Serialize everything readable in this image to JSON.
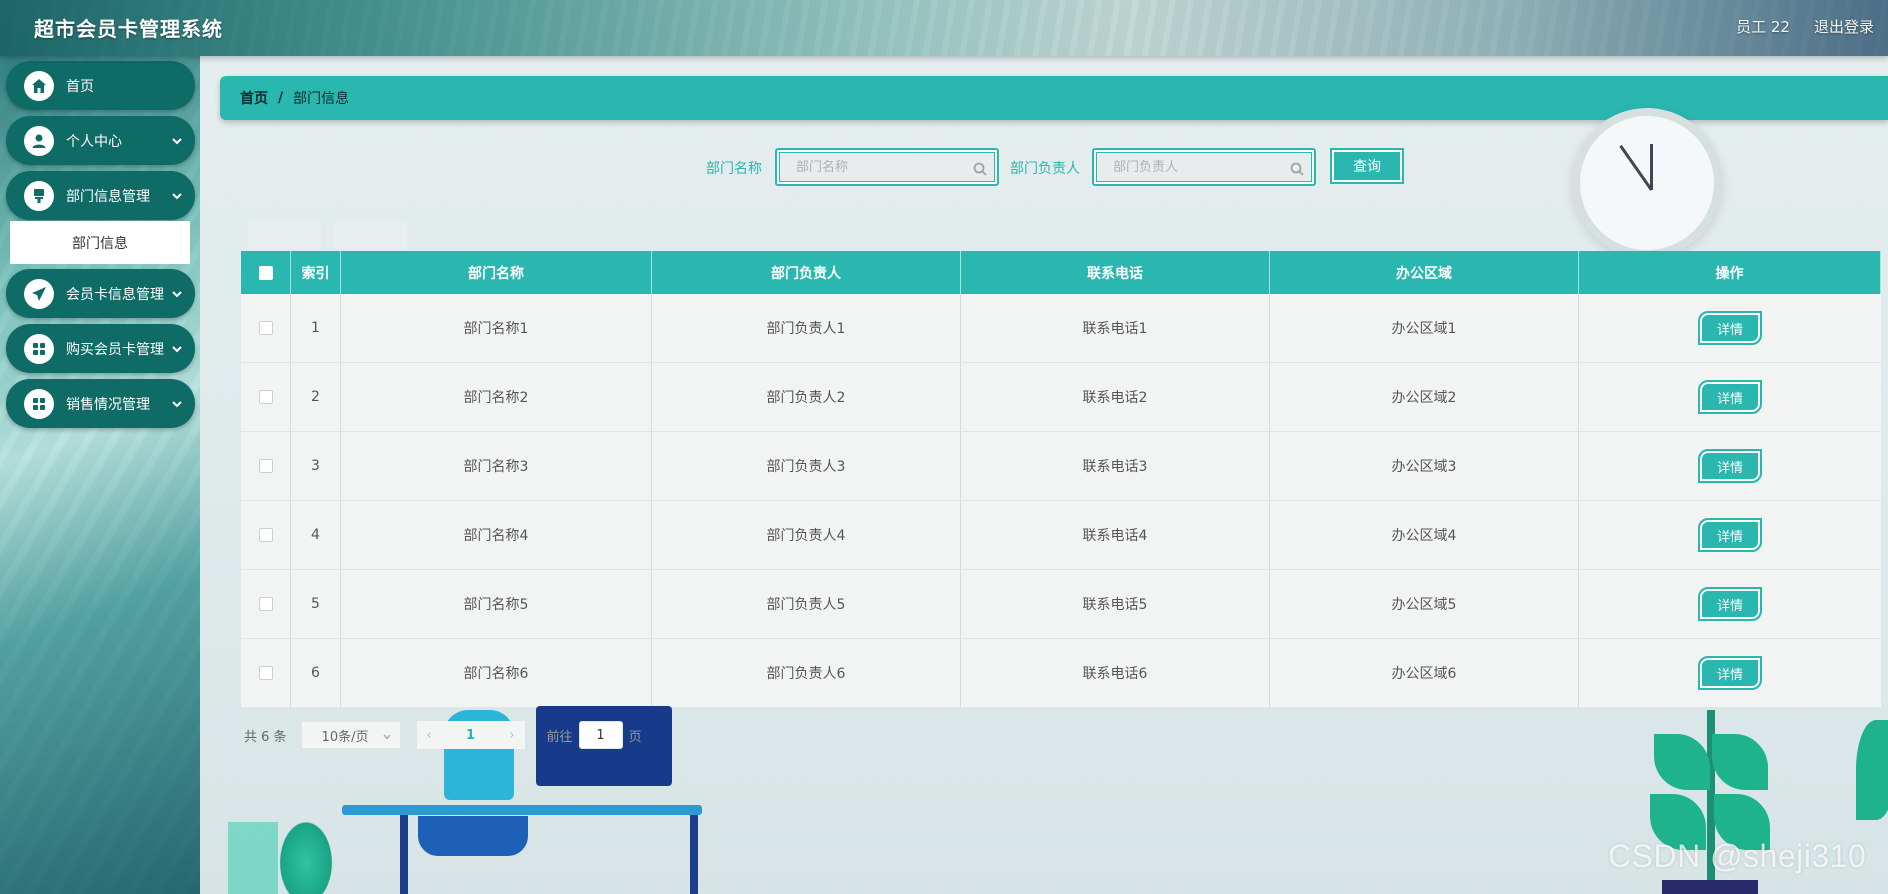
{
  "app": {
    "title": "超市会员卡管理系统"
  },
  "header": {
    "user_label": "员工 22",
    "logout_label": "退出登录"
  },
  "sidebar": {
    "items": [
      {
        "label": "首页",
        "icon": "home-icon",
        "has_children": false
      },
      {
        "label": "个人中心",
        "icon": "user-icon",
        "has_children": true
      },
      {
        "label": "部门信息管理",
        "icon": "dept-icon",
        "has_children": true
      },
      {
        "label": "会员卡信息管理",
        "icon": "send-icon",
        "has_children": true
      },
      {
        "label": "购买会员卡管理",
        "icon": "grid-icon",
        "has_children": true
      },
      {
        "label": "销售情况管理",
        "icon": "grid-icon",
        "has_children": true
      }
    ],
    "sub_item": {
      "label": "部门信息"
    }
  },
  "breadcrumb": {
    "home": "首页",
    "sep": "/",
    "current": "部门信息"
  },
  "search": {
    "name_label": "部门名称",
    "name_placeholder": "部门名称",
    "head_label": "部门负责人",
    "head_placeholder": "部门负责人",
    "query_label": "查询"
  },
  "table": {
    "headers": [
      "索引",
      "部门名称",
      "部门负责人",
      "联系电话",
      "办公区域",
      "操作"
    ],
    "rows": [
      {
        "index": "1",
        "name": "部门名称1",
        "head": "部门负责人1",
        "phone": "联系电话1",
        "area": "办公区域1",
        "action": "详情"
      },
      {
        "index": "2",
        "name": "部门名称2",
        "head": "部门负责人2",
        "phone": "联系电话2",
        "area": "办公区域2",
        "action": "详情"
      },
      {
        "index": "3",
        "name": "部门名称3",
        "head": "部门负责人3",
        "phone": "联系电话3",
        "area": "办公区域3",
        "action": "详情"
      },
      {
        "index": "4",
        "name": "部门名称4",
        "head": "部门负责人4",
        "phone": "联系电话4",
        "area": "办公区域4",
        "action": "详情"
      },
      {
        "index": "5",
        "name": "部门名称5",
        "head": "部门负责人5",
        "phone": "联系电话5",
        "area": "办公区域5",
        "action": "详情"
      },
      {
        "index": "6",
        "name": "部门名称6",
        "head": "部门负责人6",
        "phone": "联系电话6",
        "area": "办公区域6",
        "action": "详情"
      }
    ]
  },
  "pagination": {
    "total": "共 6 条",
    "page_size": "10条/页",
    "current_page": "1",
    "goto_prefix": "前往",
    "goto_value": "1",
    "goto_suffix": "页"
  },
  "watermark": "CSDN @sheji310",
  "colors": {
    "accent": "#2ab7b0",
    "sidebar_item": "#0f6b66"
  }
}
